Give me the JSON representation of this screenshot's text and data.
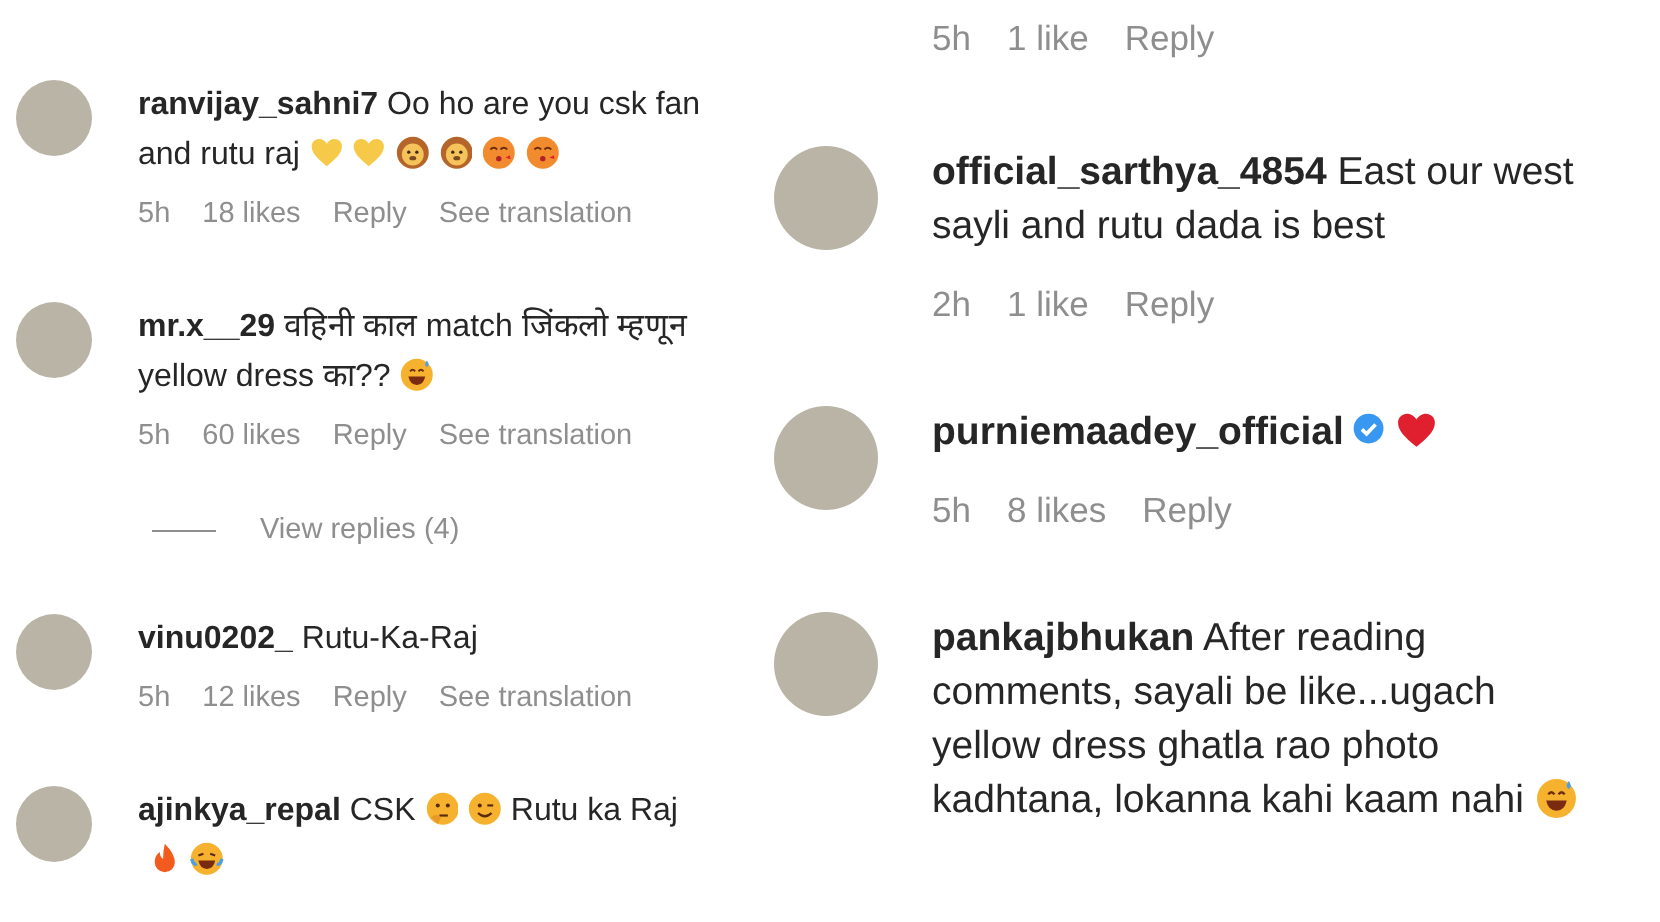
{
  "columns": [
    {
      "items": [
        {
          "kind": "comment",
          "username": "ranvijay_sahni7",
          "body": [
            {
              "kind": "text",
              "text": "Oo ho are you csk fan and rutu raj"
            },
            {
              "kind": "heart",
              "color": "#f7c948"
            },
            {
              "kind": "heart",
              "color": "#f7c948"
            },
            {
              "kind": "lion"
            },
            {
              "kind": "lion"
            },
            {
              "kind": "kiss"
            },
            {
              "kind": "kiss"
            }
          ],
          "meta": {
            "time": "5h",
            "likes": "18 likes",
            "reply": "Reply",
            "translate": "See translation"
          }
        },
        {
          "kind": "comment",
          "username": "mr.x__29",
          "body": [
            {
              "kind": "text",
              "text": "वहिनी काल match जिंकलो म्हणून yellow dress का??"
            },
            {
              "kind": "grin-sweat"
            }
          ],
          "meta": {
            "time": "5h",
            "likes": "60 likes",
            "reply": "Reply",
            "translate": "See translation"
          }
        },
        {
          "kind": "replies",
          "label": "View replies (4)"
        },
        {
          "kind": "comment",
          "username": "vinu0202_",
          "body": [
            {
              "kind": "text",
              "text": "Rutu-Ka-Raj"
            }
          ],
          "meta": {
            "time": "5h",
            "likes": "12 likes",
            "reply": "Reply",
            "translate": "See translation"
          }
        },
        {
          "kind": "comment",
          "username": "ajinkya_repal",
          "body": [
            {
              "kind": "text",
              "text": "CSK"
            },
            {
              "kind": "thinking"
            },
            {
              "kind": "wink"
            },
            {
              "kind": "text",
              "text": "Rutu ka Raj"
            },
            {
              "kind": "fire"
            },
            {
              "kind": "laugh-cry"
            }
          ]
        }
      ]
    },
    {
      "items": [
        {
          "kind": "meta",
          "meta": {
            "time": "5h",
            "likes": "1 like",
            "reply": "Reply"
          }
        },
        {
          "kind": "comment",
          "username": "official_sarthya_4854",
          "body": [
            {
              "kind": "text",
              "text": "East our west sayli and rutu dada is best"
            }
          ],
          "meta": {
            "time": "2h",
            "likes": "1 like",
            "reply": "Reply"
          }
        },
        {
          "kind": "comment",
          "username": "purniemaadey_official",
          "verified": true,
          "body": [
            {
              "kind": "heart",
              "color": "#e0202e"
            }
          ],
          "meta": {
            "time": "5h",
            "likes": "8 likes",
            "reply": "Reply"
          }
        },
        {
          "kind": "comment",
          "username": "pankajbhukan",
          "body": [
            {
              "kind": "text",
              "text": "After reading comments, sayali be like...ugach yellow dress ghatla rao photo kadhtana, lokanna kahi kaam nahi"
            },
            {
              "kind": "grin-sweat"
            }
          ]
        }
      ]
    }
  ]
}
